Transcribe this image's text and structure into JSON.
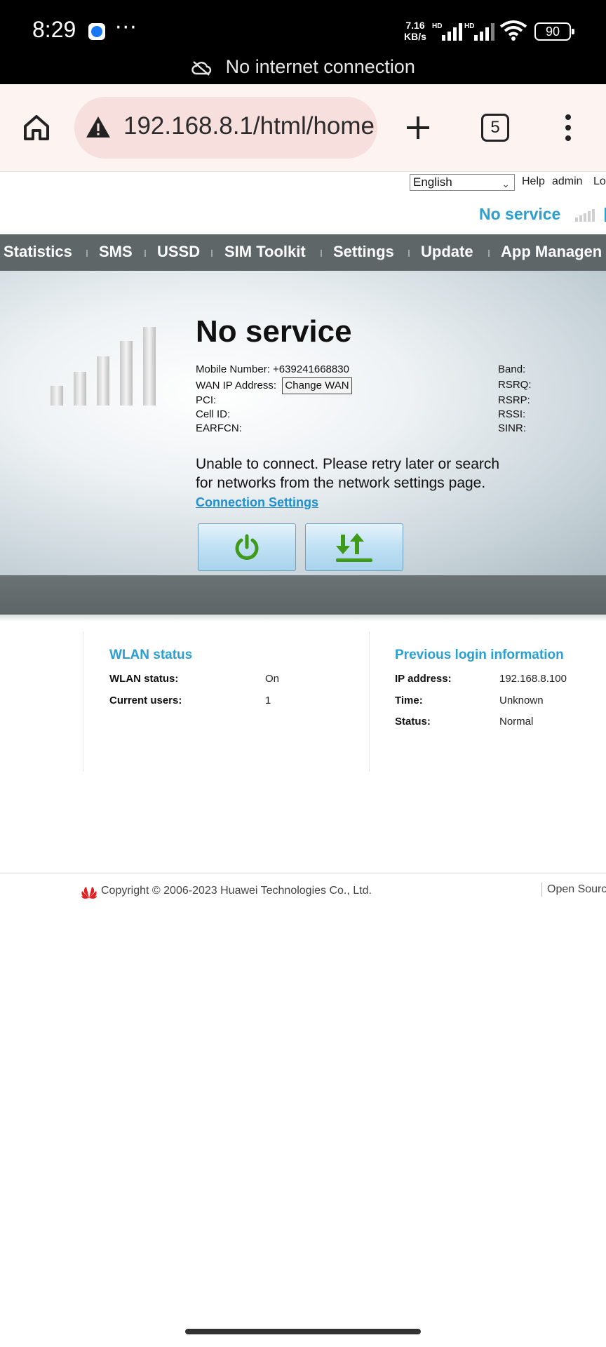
{
  "status_bar": {
    "time": "8:29",
    "dots": "···",
    "speed_value": "7.16",
    "speed_unit": "KB/s",
    "sim1_label": "HD",
    "sim2_label": "HD",
    "battery": "90",
    "notice": "No internet connection"
  },
  "browser": {
    "url": "192.168.8.1/html/home",
    "tab_count": "5"
  },
  "router": {
    "language_selected": "English",
    "help_link": "Help",
    "user": "admin",
    "logout_link": "Lo",
    "service_status": "No service",
    "nav": [
      "Statistics",
      "SMS",
      "USSD",
      "SIM Toolkit",
      "Settings",
      "Update",
      "App Managen"
    ],
    "hero_title": "No service",
    "mobile_number": "Mobile Number: +639241668830",
    "wan_ip_label": "WAN IP Address:",
    "change_wan_label": "Change WAN",
    "pci_label": "PCI:",
    "cell_id_label": "Cell ID:",
    "earfcn_label": "EARFCN:",
    "band_label": "Band:",
    "rsrq_label": "RSRQ:",
    "rsrp_label": "RSRP:",
    "rssi_label": "RSSI:",
    "sinr_label": "SINR:",
    "message": "Unable to connect. Please retry later or search for networks from the network settings page.",
    "connection_settings_link": "Connection Settings",
    "wlan": {
      "title": "WLAN status",
      "status_label": "WLAN status:",
      "status_value": "On",
      "users_label": "Current users:",
      "users_value": "1"
    },
    "login_info": {
      "title": "Previous login information",
      "ip_label": "IP address:",
      "ip_value": "192.168.8.100",
      "time_label": "Time:",
      "time_value": "Unknown",
      "status_label": "Status:",
      "status_value": "Normal"
    },
    "copyright": "Copyright © 2006-2023 Huawei Technologies Co., Ltd.",
    "open_source": "Open Sourc"
  },
  "colors": {
    "accent_blue": "#2a9fd0",
    "nav_bg": "#5e6668",
    "button_green": "#3f9a1a"
  }
}
